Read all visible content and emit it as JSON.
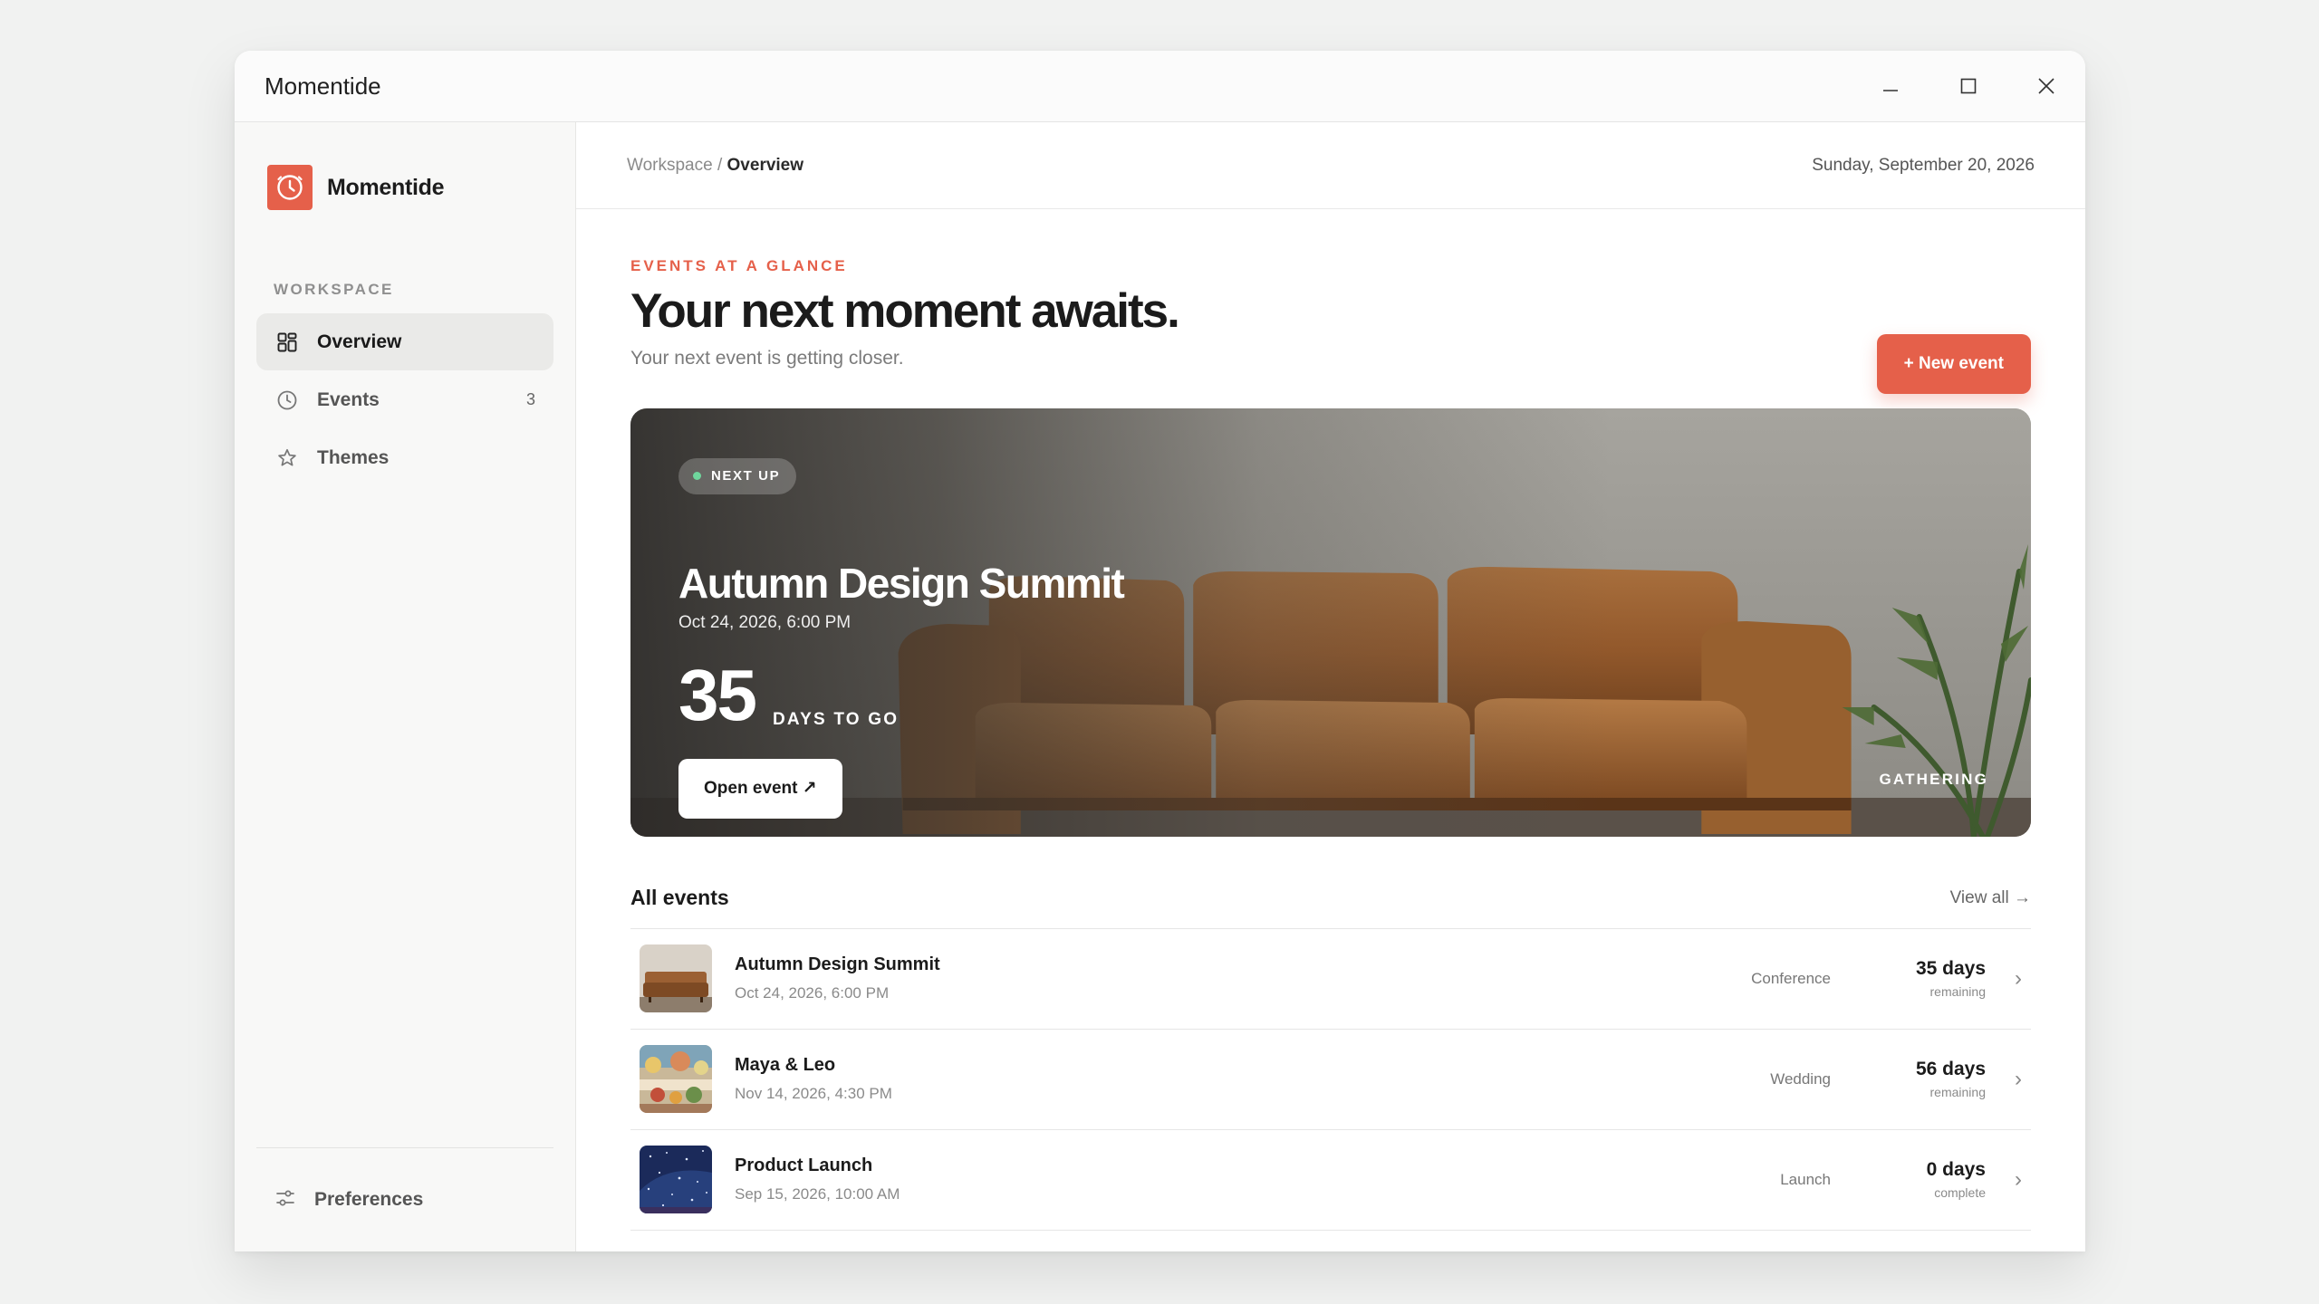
{
  "window": {
    "title": "Momentide"
  },
  "sidebar": {
    "brand": "Momentide",
    "section_label": "WORKSPACE",
    "items": [
      {
        "label": "Overview",
        "icon": "grid-icon",
        "active": true,
        "count": ""
      },
      {
        "label": "Events",
        "icon": "clock-icon",
        "active": false,
        "count": "3"
      },
      {
        "label": "Themes",
        "icon": "star-icon",
        "active": false,
        "count": ""
      }
    ],
    "footer": {
      "label": "Preferences",
      "icon": "sliders-icon"
    }
  },
  "topbar": {
    "breadcrumb_root": "Workspace",
    "breadcrumb_sep": " / ",
    "breadcrumb_current": "Overview",
    "date": "Sunday, September 20, 2026"
  },
  "header": {
    "eyebrow": "EVENTS AT A GLANCE",
    "headline": "Your next moment awaits.",
    "subline": "Your next event is getting closer.",
    "new_button": "+ New event"
  },
  "hero": {
    "badge": "NEXT UP",
    "title": "Autumn Design Summit",
    "date": "Oct 24, 2026, 6:00 PM",
    "days": "35",
    "days_label": "DAYS TO GO",
    "open_button": "Open event ↗",
    "tag": "GATHERING"
  },
  "events": {
    "title": "All events",
    "view_all": "View all →",
    "rows": [
      {
        "name": "Autumn Design Summit",
        "date": "Oct 24, 2026, 6:00 PM",
        "category": "Conference",
        "days": "35 days",
        "status": "remaining",
        "thumb": "sofa"
      },
      {
        "name": "Maya & Leo",
        "date": "Nov 14, 2026, 4:30 PM",
        "category": "Wedding",
        "days": "56 days",
        "status": "remaining",
        "thumb": "dinner"
      },
      {
        "name": "Product Launch",
        "date": "Sep 15, 2026, 10:00 AM",
        "category": "Launch",
        "days": "0 days",
        "status": "complete",
        "thumb": "sky"
      }
    ]
  },
  "colors": {
    "accent": "#e5604a",
    "badge_dot": "#6fd69d"
  }
}
